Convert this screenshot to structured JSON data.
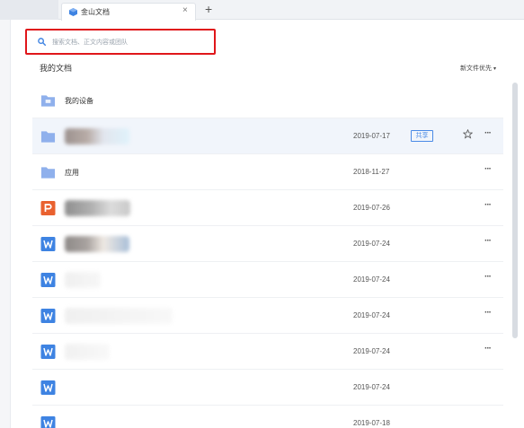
{
  "tabs": [
    {
      "title": "金山文档",
      "close": "×"
    }
  ],
  "new_tab": "+",
  "search": {
    "placeholder": "搜索文档、正文内容或团队"
  },
  "section_title": "我的文档",
  "sort": {
    "label": "新文件优先",
    "arrow": "▾"
  },
  "files": [
    {
      "name": "我的设备",
      "date": "",
      "type": "folder",
      "share": "",
      "star": false,
      "more": ""
    },
    {
      "name": "",
      "date": "2019-07-17",
      "type": "folder",
      "share": "共享",
      "star": true,
      "more": "···"
    },
    {
      "name": "应用",
      "date": "2018-11-27",
      "type": "folder",
      "share": "",
      "star": false,
      "more": "···"
    },
    {
      "name": "",
      "date": "2019-07-26",
      "type": "ppt",
      "share": "",
      "star": false,
      "more": "···"
    },
    {
      "name": "",
      "date": "2019-07-24",
      "type": "word",
      "share": "",
      "star": false,
      "more": "···"
    },
    {
      "name": "",
      "date": "2019-07-24",
      "type": "word",
      "share": "",
      "star": false,
      "more": "···"
    },
    {
      "name": "",
      "date": "2019-07-24",
      "type": "word",
      "share": "",
      "star": false,
      "more": "···"
    },
    {
      "name": "",
      "date": "2019-07-24",
      "type": "word",
      "share": "",
      "star": false,
      "more": "···"
    },
    {
      "name": "",
      "date": "2019-07-24",
      "type": "word",
      "share": "",
      "star": false,
      "more": ""
    },
    {
      "name": "",
      "date": "2019-07-18",
      "type": "word",
      "share": "",
      "star": false,
      "more": ""
    }
  ],
  "colors": {
    "accent": "#4a8ae6",
    "highlight_border": "#e0161a",
    "folder": "#8fb0ec",
    "ppt": "#e9612f",
    "word": "#3e83e2"
  }
}
